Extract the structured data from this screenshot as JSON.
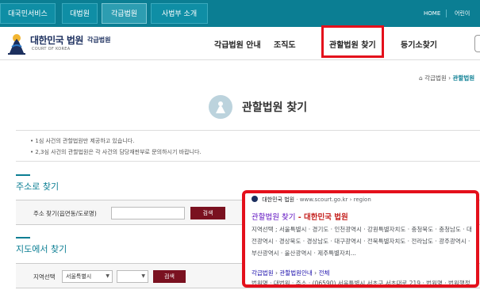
{
  "topbar": {
    "tabs": [
      "대국민서비스",
      "대법원",
      "각급법원",
      "사법부 소개"
    ],
    "utils": [
      "HOME",
      "어린이"
    ]
  },
  "header": {
    "logo_title": "대한민국 법원",
    "logo_sub": "각급법원",
    "logo_en": "COURT OF KOREA",
    "menu": [
      "각급법원 안내",
      "조직도",
      "관할법원 찾기",
      "등기소찾기"
    ]
  },
  "breadcrumb": {
    "parent": "각급법원",
    "current": "관할법원"
  },
  "page_title": "관할법원 찾기",
  "notice": [
    "1심 사건의 관할법원만 제공하고 있습니다.",
    "2,3심 사건의 관할법원은 각 사건의 담당재판부로 문의하시기 바랍니다."
  ],
  "address_section": {
    "title": "주소로 찾기",
    "label": "주소 찾기(읍면동/도로명)",
    "input_value": "",
    "search_label": "검색"
  },
  "map_section": {
    "title": "지도에서 찾기",
    "label": "지역선택",
    "region_selected": "서울특별시",
    "subregion_selected": "",
    "search_label": "검색"
  },
  "search_result": {
    "site_name": "대한민국 법원",
    "site_url": "· www.scourt.go.kr › region",
    "headline_main": "관할법원 찾기",
    "headline_rest": " - 대한민국 법원",
    "snippet": "지역선택 ; 서울특별시 · 경기도 · 인천광역시 · 강원특별자치도 · 충청북도 · 충청남도 · 대전광역시 · 경상북도 · 경상남도 · 대구광역시 · 전북특별자치도 · 전라남도 · 광주광역시 · 부산광역시 · 울산광역시 · 제주특별자치...",
    "crumb_a": "각급법원",
    "crumb_b": "관할법원안내",
    "crumb_c": "전체",
    "cut_line": "법원명 · 대법원 · 주소 · (06590) 서울특별시 서초구 서초대로 219 · 법원명 · 법원행정"
  },
  "colors": {
    "brand_teal": "#0b7e93",
    "button_maroon": "#7a1120",
    "highlight_red": "#e4101b"
  }
}
